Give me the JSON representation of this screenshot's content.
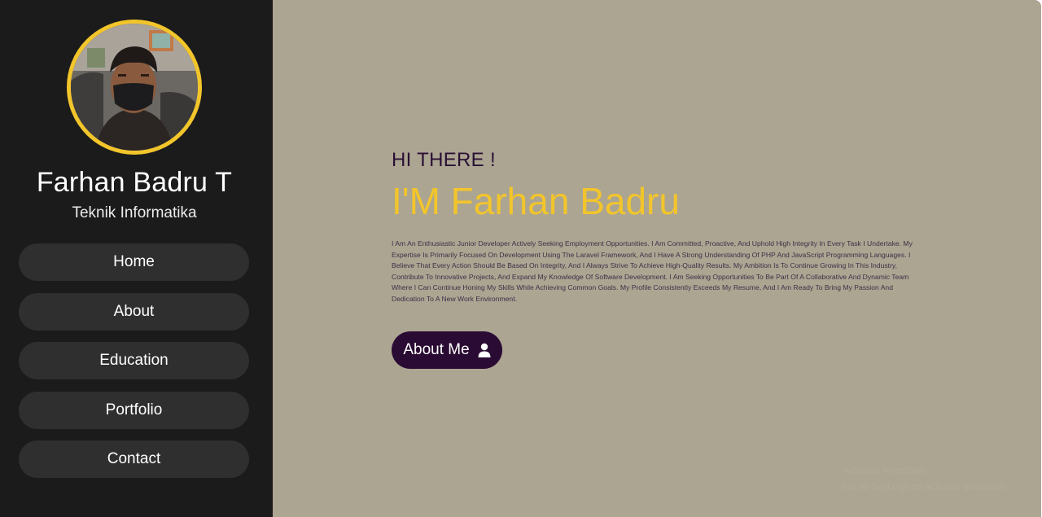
{
  "profile": {
    "name": "Farhan Badru T",
    "major": "Teknik Informatika",
    "avatar_icon": "profile-photo"
  },
  "nav": {
    "items": [
      {
        "label": "Home"
      },
      {
        "label": "About"
      },
      {
        "label": "Education"
      },
      {
        "label": "Portfolio"
      },
      {
        "label": "Contact"
      }
    ]
  },
  "hero": {
    "greeting": "HI THERE !",
    "headline": "I'M Farhan Badru",
    "bio": "I Am An Enthusiastic Junior Developer Actively Seeking Employment Opportunities. I Am Committed, Proactive, And Uphold High Integrity In Every Task I Undertake. My Expertise Is Primarily Focused On Development Using The Laravel Framework, And I Have A Strong Understanding Of PHP And JavaScript Programming Languages. I Believe That Every Action Should Be Based On Integrity, And I Always Strive To Achieve High-Quality Results. My Ambition Is To Continue Growing In This Industry, Contribute To Innovative Projects, And Expand My Knowledge Of Software Development. I Am Seeking Opportunities To Be Part Of A Collaborative And Dynamic Team Where I Can Continue Honing My Skills While Achieving Common Goals. My Profile Consistently Exceeds My Resume, And I Am Ready To Bring My Passion And Dedication To A New Work Environment.",
    "button_label": "About Me",
    "button_icon": "user-icon"
  },
  "watermark": {
    "line1": "Activate Windows",
    "line2": "Go to Settings to activate Windows."
  },
  "colors": {
    "sidebar_bg": "#1b1b1b",
    "nav_button_bg": "#2f2f2f",
    "main_bg": "#aca592",
    "accent_yellow": "#f2c52b",
    "dark_purple": "#2a0b33"
  }
}
